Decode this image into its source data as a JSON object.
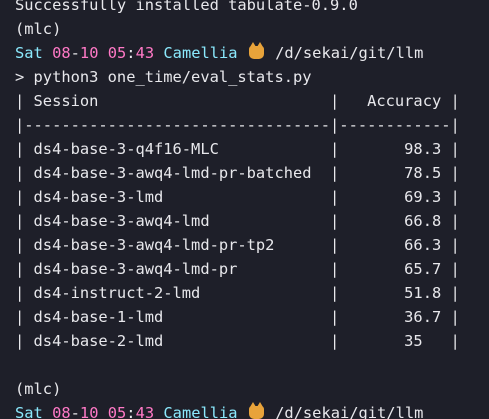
{
  "terminal": {
    "line_install": "Successfully installed tabulate-0.9.0",
    "env1": "(mlc)",
    "prompt1": {
      "day": "Sat",
      "date_month": "08",
      "date_sep": "-",
      "date_day": "10",
      "time_hour": "05",
      "time_sep": ":",
      "time_min": "43",
      "host": "Camellia",
      "icon": "cat-icon",
      "path": "/d/sekai/git/llm"
    },
    "command": "> python3 one_time/eval_stats.py",
    "table": {
      "header": "| Session                         |   Accuracy |",
      "separator": "|---------------------------------|------------|",
      "rows": [
        "| ds4-base-3-q4f16-MLC            |       98.3 |",
        "| ds4-base-3-awq4-lmd-pr-batched  |       78.5 |",
        "| ds4-base-3-lmd                  |       69.3 |",
        "| ds4-base-3-awq4-lmd             |       66.8 |",
        "| ds4-base-3-awq4-lmd-pr-tp2      |       66.3 |",
        "| ds4-base-3-awq4-lmd-pr          |       65.7 |",
        "| ds4-instruct-2-lmd              |       51.8 |",
        "| ds4-base-1-lmd                  |       36.7 |",
        "| ds4-base-2-lmd                  |       35   |"
      ]
    },
    "env2": "(mlc)",
    "prompt2": {
      "day": "Sat",
      "date_month": "08",
      "date_sep": "-",
      "date_day": "10",
      "time_hour": "05",
      "time_sep": ":",
      "time_min": "43",
      "host": "Camellia",
      "icon": "cat-icon",
      "path": "/d/sekai/git/llm"
    }
  },
  "colors": {
    "background": "#1e1f29",
    "foreground": "#e8e8ec",
    "cyan": "#8be9fd",
    "pink": "#ff79c6"
  }
}
